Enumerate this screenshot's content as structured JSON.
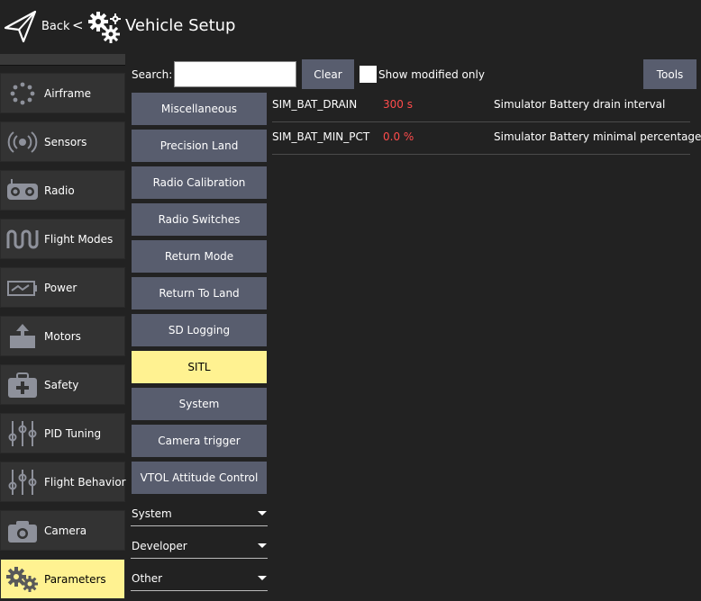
{
  "header": {
    "back_label": "Back",
    "back_separator": "<",
    "title": "Vehicle Setup"
  },
  "sidebar": {
    "items": [
      {
        "label": "Airframe",
        "icon": "airframe-icon"
      },
      {
        "label": "Sensors",
        "icon": "sensors-icon"
      },
      {
        "label": "Radio",
        "icon": "radio-icon"
      },
      {
        "label": "Flight Modes",
        "icon": "flight-modes-icon"
      },
      {
        "label": "Power",
        "icon": "power-icon"
      },
      {
        "label": "Motors",
        "icon": "motors-icon"
      },
      {
        "label": "Safety",
        "icon": "safety-icon"
      },
      {
        "label": "PID Tuning",
        "icon": "pid-tuning-icon"
      },
      {
        "label": "Flight Behavior",
        "icon": "flight-behavior-icon"
      },
      {
        "label": "Camera",
        "icon": "camera-icon"
      },
      {
        "label": "Parameters",
        "icon": "parameters-icon",
        "active": true
      }
    ]
  },
  "search": {
    "label": "Search:",
    "value": "",
    "placeholder": "",
    "clear_label": "Clear",
    "show_modified_label": "Show modified only",
    "show_modified_checked": false,
    "tools_label": "Tools"
  },
  "groups": {
    "buttons": [
      "Miscellaneous",
      "Precision Land",
      "Radio Calibration",
      "Radio Switches",
      "Return Mode",
      "Return To Land",
      "SD Logging",
      "SITL",
      "System",
      "Camera trigger",
      "VTOL Attitude Control"
    ],
    "active": "SITL",
    "dropdowns": [
      "System",
      "Developer",
      "Other"
    ]
  },
  "params": [
    {
      "name": "SIM_BAT_DRAIN",
      "value": "300 s",
      "description": "Simulator Battery drain interval"
    },
    {
      "name": "SIM_BAT_MIN_PCT",
      "value": "0.0 %",
      "description": "Simulator Battery minimal percentage"
    }
  ],
  "colors": {
    "background": "#222222",
    "panel": "#333333",
    "button": "#585d6e",
    "active": "#fff291",
    "modified_value": "#ff4c4c"
  }
}
